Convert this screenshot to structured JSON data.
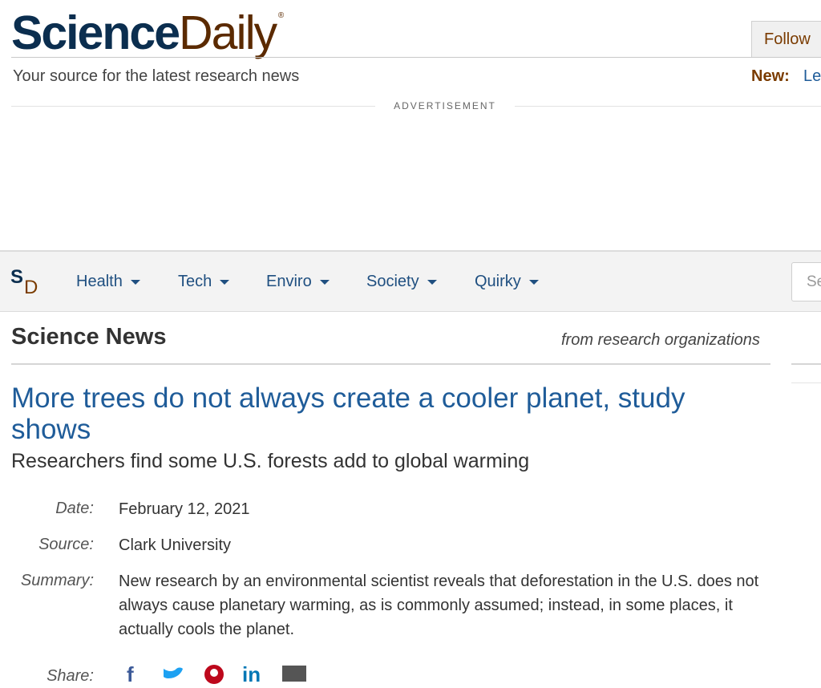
{
  "header": {
    "logo_science": "Science",
    "logo_daily": "Daily",
    "logo_reg": "®",
    "tagline": "Your source for the latest research news",
    "follow_label": "Follow",
    "new_label": "New:",
    "new_link": "Le"
  },
  "advertisement": {
    "label": "ADVERTISEMENT"
  },
  "nav": {
    "logo_s": "S",
    "logo_d": "D",
    "items": [
      {
        "label": "Health"
      },
      {
        "label": "Tech"
      },
      {
        "label": "Enviro"
      },
      {
        "label": "Society"
      },
      {
        "label": "Quirky"
      }
    ],
    "search_placeholder": "Se"
  },
  "section": {
    "title": "Science News",
    "subtitle": "from research organizations"
  },
  "article": {
    "headline": "More trees do not always create a cooler planet, study shows",
    "subhead": "Researchers find some U.S. forests add to global warming",
    "date_label": "Date:",
    "date": "February 12, 2021",
    "source_label": "Source:",
    "source": "Clark University",
    "summary_label": "Summary:",
    "summary": "New research by an environmental scientist reveals that deforestation in the U.S. does not always cause planetary warming, as is commonly assumed; instead, in some places, it actually cools the planet.",
    "share_label": "Share:"
  },
  "colors": {
    "brand_navy": "#0b2e4f",
    "brand_brown": "#5b2a00",
    "link_blue": "#1f5c99",
    "facebook": "#3b5998",
    "twitter": "#1da1f2",
    "pinterest": "#bd081c",
    "linkedin": "#0077b5",
    "email": "#555555"
  },
  "share_icons": [
    "facebook-icon",
    "twitter-icon",
    "pinterest-icon",
    "linkedin-icon",
    "email-icon"
  ]
}
